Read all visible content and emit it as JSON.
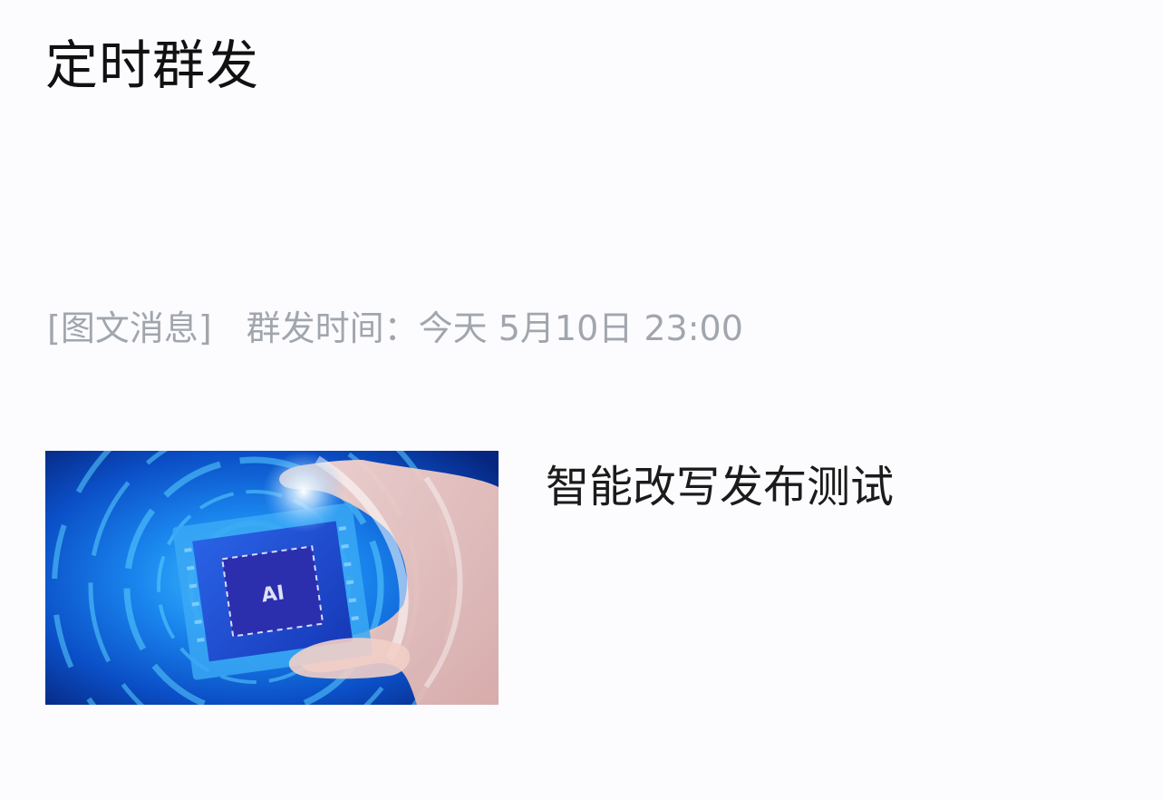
{
  "header": {
    "title": "定时群发"
  },
  "scheduled_item": {
    "message_type": "[图文消息]",
    "send_time_label": "群发时间：",
    "send_time_value": "今天 5月10日 23:00"
  },
  "article": {
    "title": "智能改写发布测试",
    "thumbnail_icon": "chip-in-hand-image"
  },
  "colors": {
    "background": "#fcfcfe",
    "title_text": "#111111",
    "meta_text": "#a1a6ae",
    "thumbnail_primary": "#1476e8"
  }
}
